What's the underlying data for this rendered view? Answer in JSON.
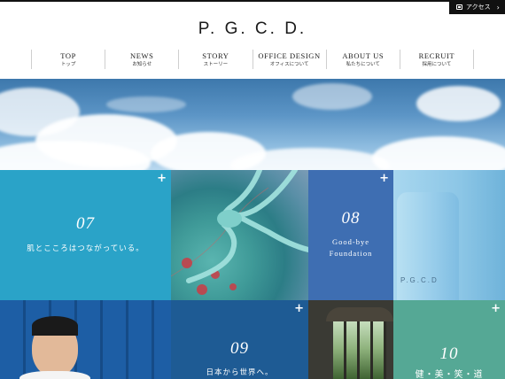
{
  "header": {
    "access_label": "アクセス",
    "logo": "P. G. C. D."
  },
  "nav": [
    {
      "en": "TOP",
      "ja": "トップ"
    },
    {
      "en": "NEWS",
      "ja": "お知らせ"
    },
    {
      "en": "STORY",
      "ja": "ストーリー"
    },
    {
      "en": "OFFICE DESIGN",
      "ja": "オフィスについて"
    },
    {
      "en": "ABOUT US",
      "ja": "私たちについて"
    },
    {
      "en": "RECRUIT",
      "ja": "採用について"
    }
  ],
  "tiles": {
    "t1": {
      "num": "07",
      "caption": "肌とこころはつながっている。"
    },
    "t3": {
      "num": "08",
      "caption_line1": "Good-bye",
      "caption_line2": "Foundation"
    },
    "t4": {
      "product_text": "P.G.C.D"
    },
    "t6": {
      "num": "09",
      "caption": "日本から世界へ。"
    },
    "t8": {
      "num": "10",
      "caption": "健・美・笑・道"
    }
  },
  "icons": {
    "plus": "+",
    "chevron": "›"
  }
}
